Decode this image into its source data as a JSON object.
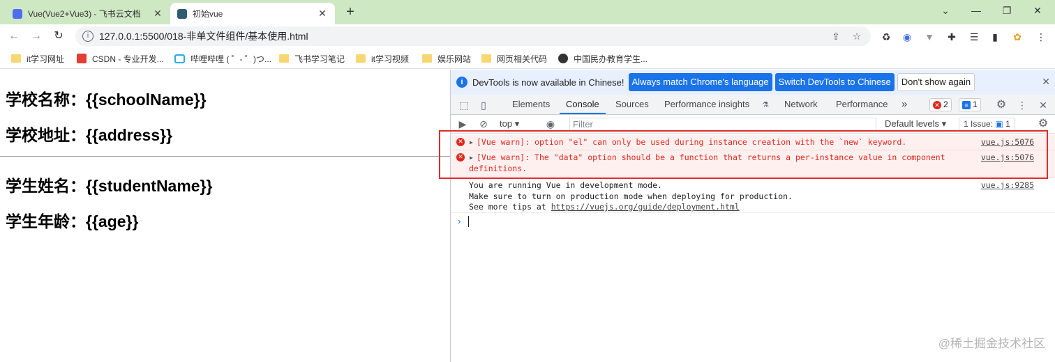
{
  "tabs": [
    {
      "title": "Vue(Vue2+Vue3) - 飞书云文档",
      "active": false
    },
    {
      "title": "初始vue",
      "active": true
    }
  ],
  "address_bar": {
    "url": "127.0.0.1:5500/018-非单文件组件/基本使用.html"
  },
  "bookmarks": [
    {
      "label": "it学习网址",
      "icon": "folder-icon"
    },
    {
      "label": "CSDN - 专业开发...",
      "icon": "csdn-icon"
    },
    {
      "label": "哔哩哔哩 ( ゜- ゜)つ...",
      "icon": "bilibili-icon"
    },
    {
      "label": "飞书学习笔记",
      "icon": "folder-icon"
    },
    {
      "label": "it学习视频",
      "icon": "folder-icon"
    },
    {
      "label": "娱乐网站",
      "icon": "folder-icon"
    },
    {
      "label": "网页相关代码",
      "icon": "folder-icon"
    },
    {
      "label": "中国民办教育学生...",
      "icon": "globe-icon"
    }
  ],
  "page": {
    "school_name": "学校名称：{{schoolName}}",
    "school_address": "学校地址：{{address}}",
    "student_name": "学生姓名：{{studentName}}",
    "student_age": "学生年龄：{{age}}"
  },
  "devtools": {
    "infobar": {
      "message": "DevTools is now available in Chinese!",
      "btn_match": "Always match Chrome's language",
      "btn_switch": "Switch DevTools to Chinese",
      "btn_dismiss": "Don't show again"
    },
    "tabs": [
      "Elements",
      "Console",
      "Sources",
      "Performance insights",
      "Network",
      "Performance",
      "»"
    ],
    "error_count": "2",
    "message_count": "1",
    "console_bar": {
      "context": "top",
      "filter_placeholder": "Filter",
      "levels": "Default levels",
      "issues_label": "1 Issue:",
      "issues_count": "1"
    },
    "logs": [
      {
        "type": "error",
        "text": "[Vue warn]: option \"el\" can only be used during instance creation with the `new` keyword.",
        "source": "vue.js:5076"
      },
      {
        "type": "error",
        "text": "[Vue warn]: The \"data\" option should be a function that returns a per-instance value in component definitions.",
        "source": "vue.js:5076"
      },
      {
        "type": "info",
        "line1": "You are running Vue in development mode.",
        "line2": "Make sure to turn on production mode when deploying for production.",
        "line3_prefix": "See more tips at ",
        "line3_link": "https://vuejs.org/guide/deployment.html",
        "source": "vue.js:9285"
      }
    ],
    "prompt_symbol": "›"
  },
  "watermark": "@稀土掘金技术社区",
  "colors": {
    "tabstrip": "#cfe8c4",
    "devtools_blue": "#1a73e8",
    "error_red": "#e0271d",
    "highlight_border": "#e02b2b"
  }
}
